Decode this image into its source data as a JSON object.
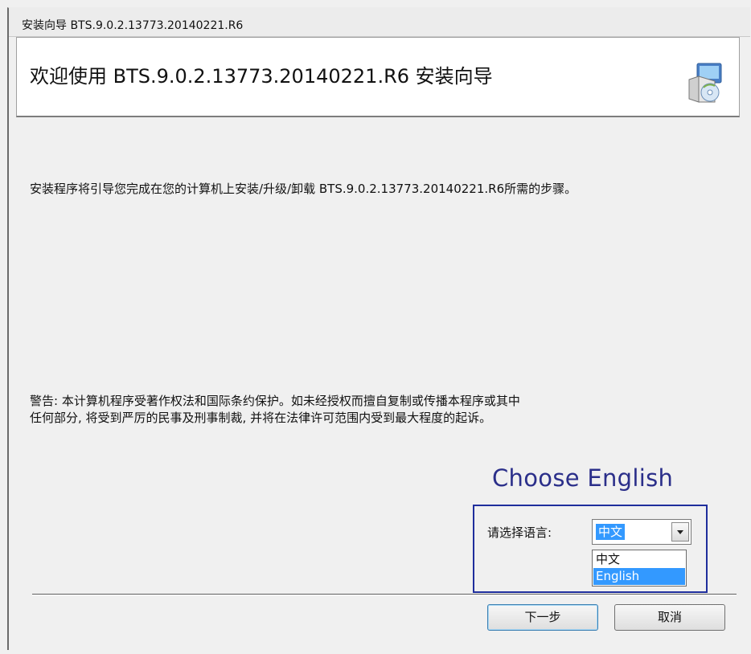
{
  "window": {
    "title": "安装向导 BTS.9.0.2.13773.20140221.R6"
  },
  "header": {
    "title": "欢迎使用 BTS.9.0.2.13773.20140221.R6 安装向导",
    "icon": "installer-package-icon"
  },
  "body": {
    "intro": "安装程序将引导您完成在您的计算机上安装/升级/卸载 BTS.9.0.2.13773.20140221.R6所需的步骤。",
    "warning_line1": "警告: 本计算机程序受著作权法和国际条约保护。如未经授权而擅自复制或传播本程序或其中",
    "warning_line2": "任何部分, 将受到严厉的民事及刑事制裁, 并将在法律许可范围内受到最大程度的起诉。"
  },
  "annotation": {
    "text": "Choose English",
    "color": "#2b2f8a",
    "box_color": "#1f2e9c"
  },
  "language": {
    "label": "请选择语言:",
    "selected": "中文",
    "options": [
      "中文",
      "English"
    ],
    "highlighted": "English"
  },
  "buttons": {
    "next": "下一步",
    "cancel": "取消"
  },
  "colors": {
    "selection": "#3399ff"
  }
}
